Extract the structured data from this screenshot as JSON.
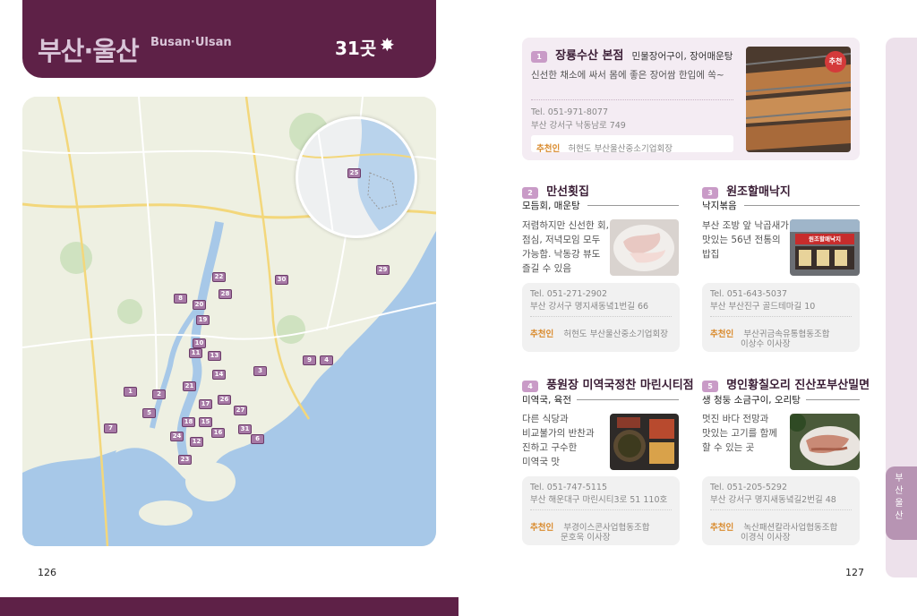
{
  "header": {
    "title_ko": "부산·울산",
    "title_en": "Busan·Ulsan",
    "count": "31곳",
    "star": "✸"
  },
  "map": {
    "markers": [
      "1",
      "2",
      "3",
      "4",
      "5",
      "6",
      "7",
      "8",
      "9",
      "10",
      "11",
      "12",
      "13",
      "14",
      "15",
      "16",
      "17",
      "18",
      "19",
      "20",
      "21",
      "22",
      "23",
      "24",
      "25",
      "26",
      "27",
      "28",
      "29",
      "30",
      "31"
    ]
  },
  "page_numbers": {
    "left": "126",
    "right": "127"
  },
  "side_tab": "부산울산",
  "restaurants": [
    {
      "num": "1",
      "name": "장룡수산 본점",
      "menu": "민물장어구이, 장어매운탕",
      "desc": "신선한 채소에 싸서 몸에 좋은 장어쌈 한입에 쏙~",
      "tel": "Tel. 051-971-8077",
      "addr": "부산 강서구 낙동남로 749",
      "rec_label": "추천인",
      "rec": "허현도 부산울산중소기업회장",
      "badge": "추천"
    },
    {
      "num": "2",
      "name": "만선횟집",
      "menu": "모듬회, 매운탕",
      "desc": [
        "저렴하지만 신선한 회,",
        "점심, 저녁모임 모두",
        "가능함. 낙동강 뷰도",
        "즐길 수 있음"
      ],
      "tel": "Tel. 051-271-2902",
      "addr": "부산 강서구 명지새동녘1번길 66",
      "rec_label": "추천인",
      "rec": "허현도 부산울산중소기업회장"
    },
    {
      "num": "3",
      "name": "원조할매낙지",
      "menu": "낙지볶음",
      "desc": [
        "부산 조방 앞 낙곱새가",
        "맛있는 56년 전통의",
        "밥집"
      ],
      "tel": "Tel. 051-643-5037",
      "addr": "부산 부산진구 골드테마길 10",
      "rec_label": "추천인",
      "rec": [
        "부산귀금속유통협동조합",
        "이상수 이사장"
      ],
      "sign": "원조할매낙지"
    },
    {
      "num": "4",
      "name": "풍원장 미역국정찬 마린시티점",
      "menu": "미역국, 육전",
      "desc": [
        "다른 식당과",
        "비교불가의 반찬과",
        "진하고 구수한",
        "미역국 맛"
      ],
      "tel": "Tel. 051-747-5115",
      "addr": "부산 해운대구 마린시티3로 51 110호",
      "rec_label": "추천인",
      "rec": [
        "부경이스콘사업협동조합",
        "문호욱 이사장"
      ]
    },
    {
      "num": "5",
      "name": "명인황칠오리 진산포부산밀면",
      "menu": "생 청둥 소금구이, 오리탕",
      "desc": [
        "멋진 바다 전망과",
        "맛있는 고기를 함께",
        "할 수 있는 곳"
      ],
      "tel": "Tel. 051-205-5292",
      "addr": "부산 강서구 명지새동녘길2번길 48",
      "rec_label": "추천인",
      "rec": [
        "녹산패션칼라사업협동조합",
        "이경식 이사장"
      ]
    }
  ]
}
